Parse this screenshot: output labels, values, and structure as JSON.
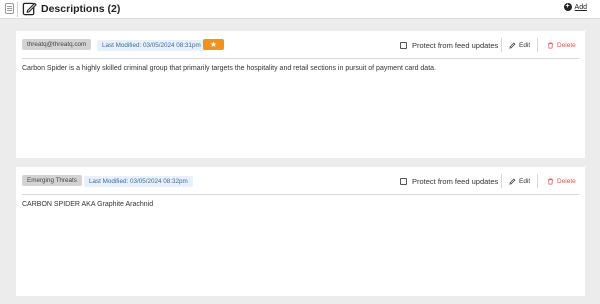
{
  "header": {
    "title": "Descriptions (2)",
    "add_label": "Add"
  },
  "colors": {
    "accent_star": "#f0931c",
    "modified_tag_bg": "#e8f1fb",
    "delete_red": "#d9534f"
  },
  "descriptions": [
    {
      "source": "threatq@threatq.com",
      "last_modified": "Last Modified: 03/05/2024 08:31pm",
      "starred": true,
      "protect_label": "Protect from feed updates",
      "protect_checked": false,
      "edit_label": "Edit",
      "delete_label": "Delete",
      "text": "Carbon Spider is a highly skilled criminal group that primarily targets the hospitality and retail sections in pursuit of payment card data."
    },
    {
      "source": "Emerging Threats",
      "last_modified": "Last Modified: 03/05/2024 08:32pm",
      "starred": false,
      "protect_label": "Protect from feed updates",
      "protect_checked": false,
      "edit_label": "Edit",
      "delete_label": "Delete",
      "text": "CARBON SPIDER AKA Graphite Arachnid"
    }
  ]
}
